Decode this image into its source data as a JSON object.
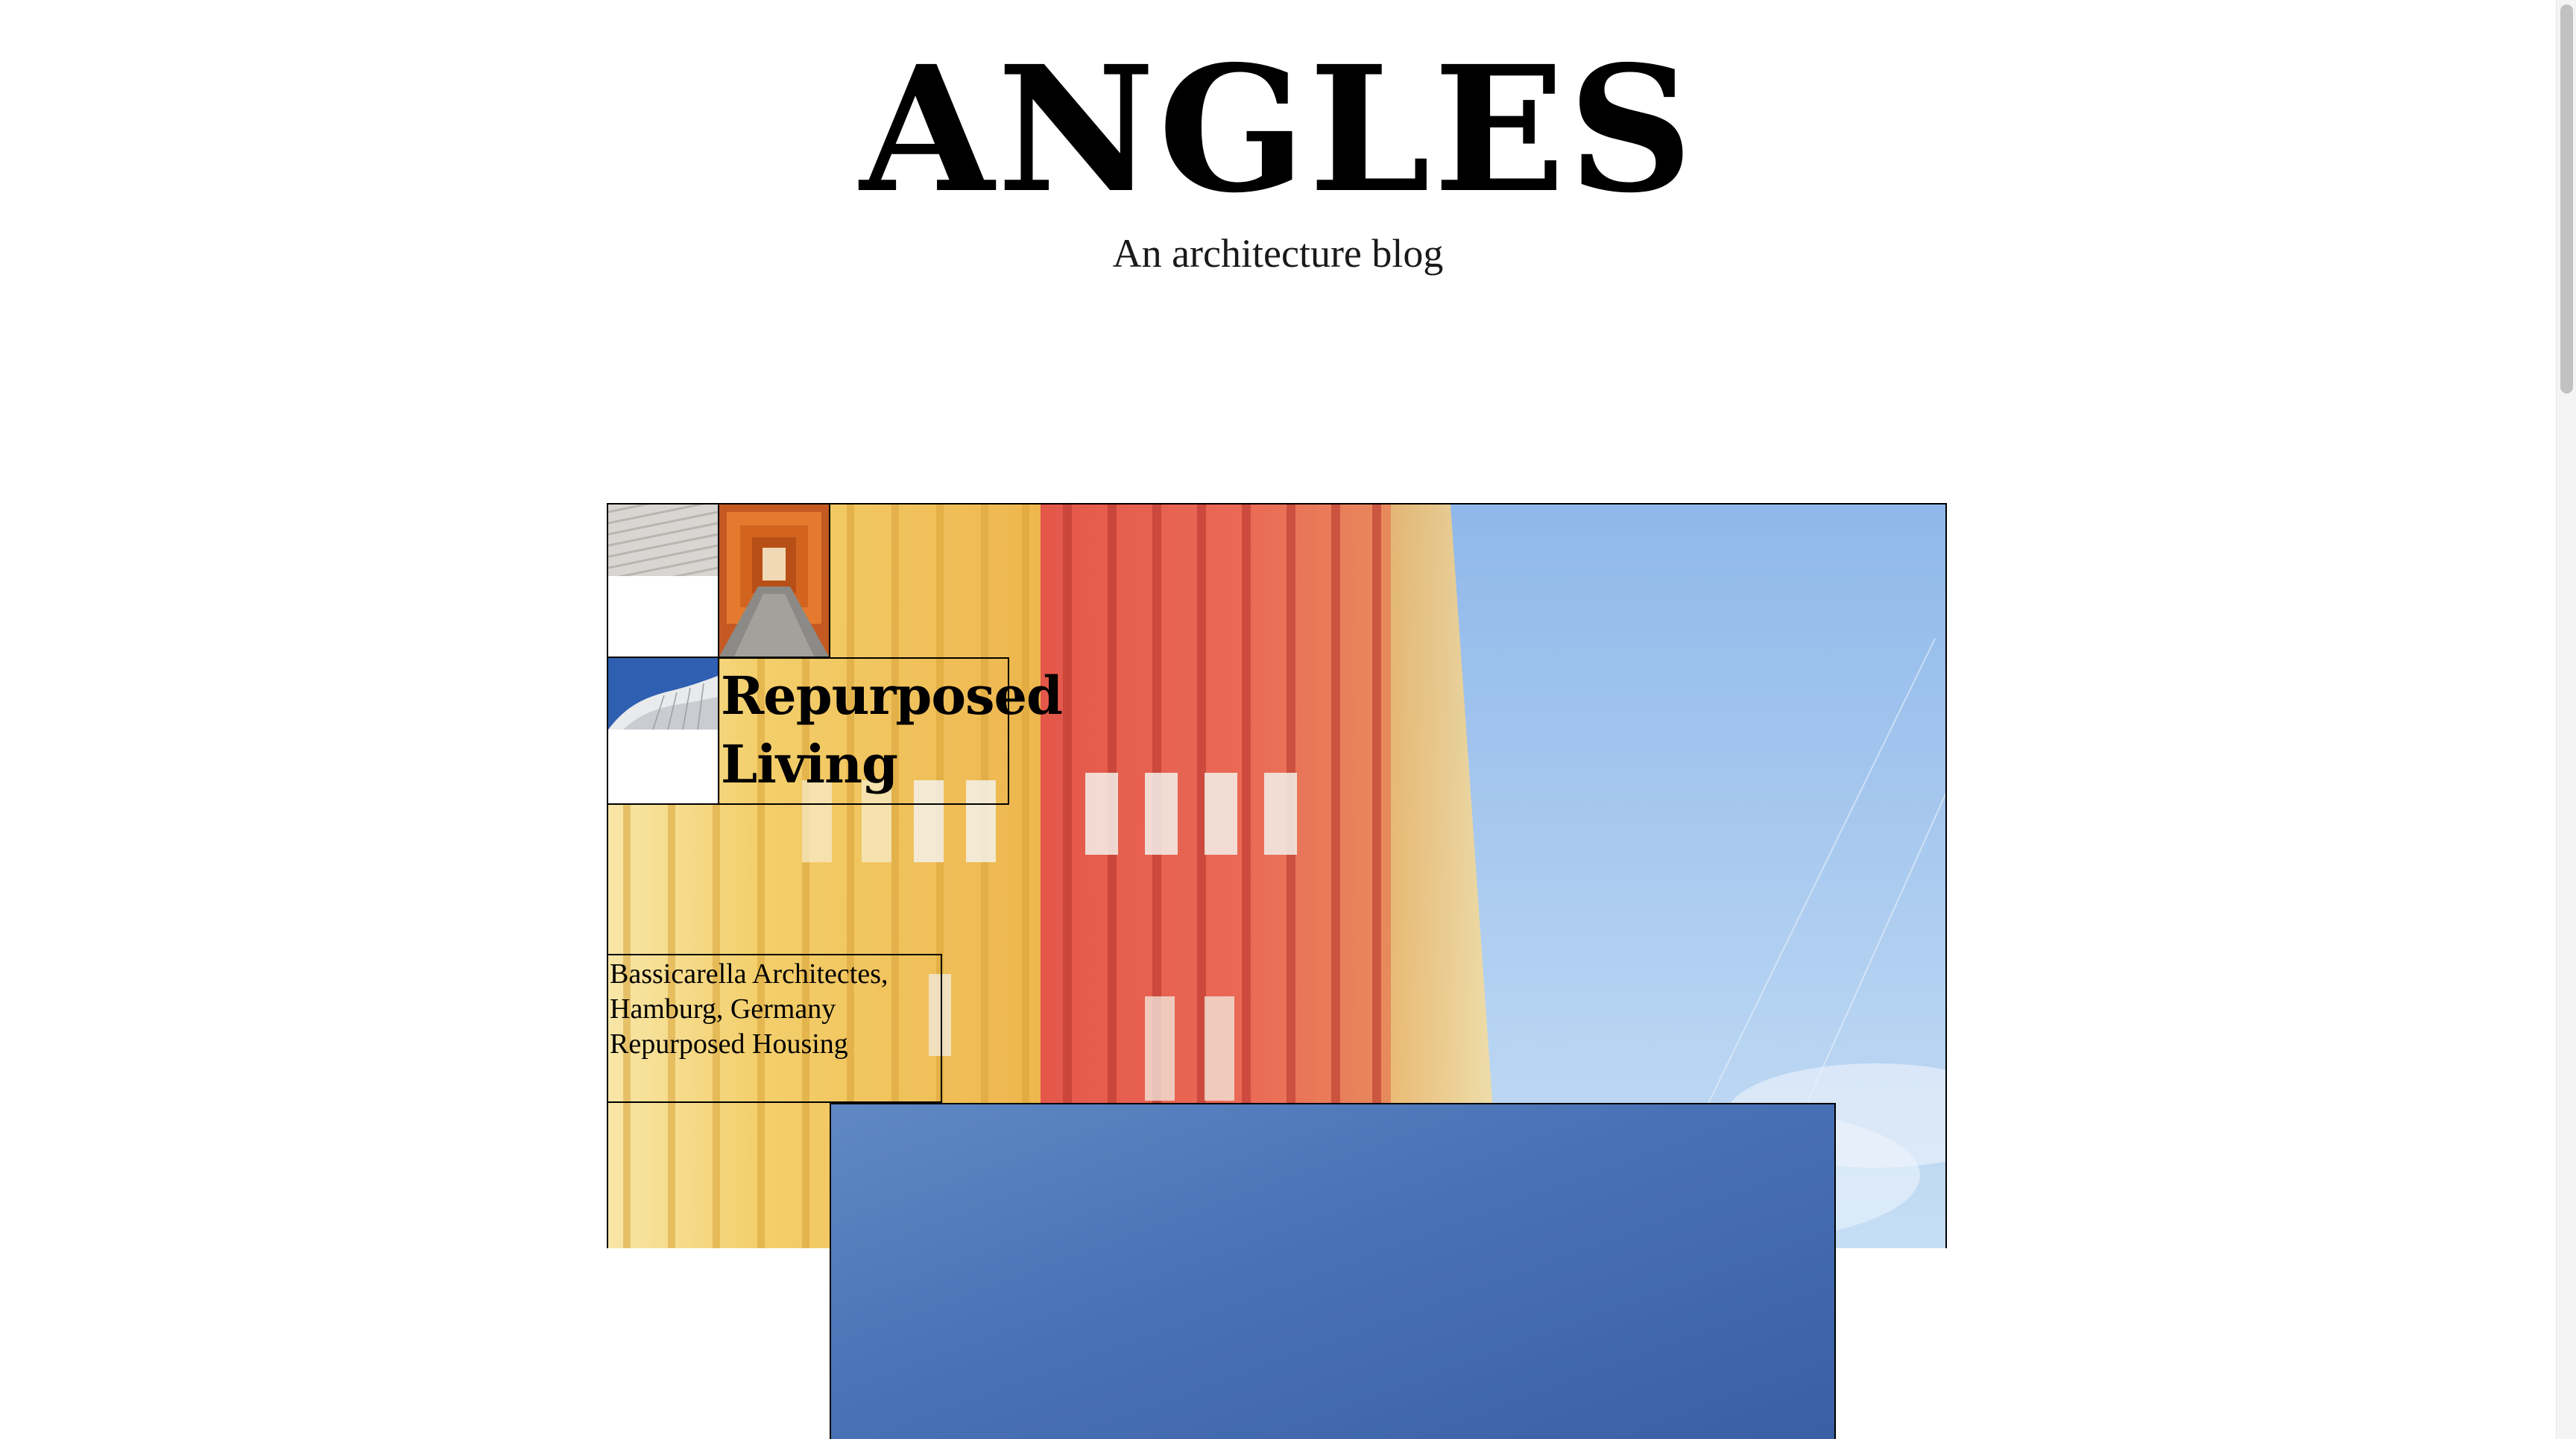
{
  "site": {
    "title": "ANGLES",
    "tagline": "An architecture blog"
  },
  "featured_post": {
    "title": "Repurposed Living",
    "meta": [
      "Bassicarella Architectes,",
      "Hamburg, Germany",
      "Repurposed Housing"
    ]
  },
  "thumbnails": [
    {
      "name": "white-facade-thumbnail"
    },
    {
      "name": "orange-corridor-thumbnail"
    },
    {
      "name": "curved-building-thumbnail"
    }
  ],
  "colors": {
    "background": "#ffffff",
    "border": "#000000",
    "sky": "#a9cbef",
    "facade_yellow": "#f2c95a",
    "facade_red": "#e55a4c",
    "card_blue": "#4a74b6"
  }
}
